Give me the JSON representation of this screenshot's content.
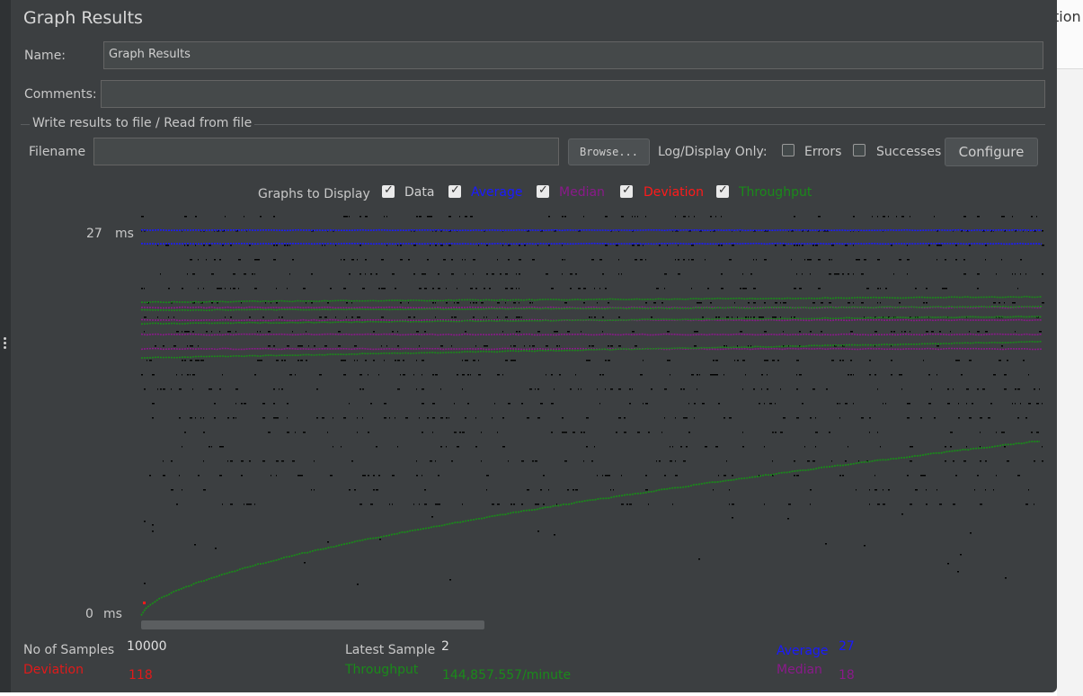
{
  "window": {
    "title": "Graph Results",
    "background_right_text": "tion"
  },
  "name_field": {
    "label": "Name:",
    "value": "Graph Results"
  },
  "comments_field": {
    "label": "Comments:",
    "value": ""
  },
  "file_group": {
    "title": "Write results to file / Read from file",
    "filename_label": "Filename",
    "filename_value": "",
    "browse_label": "Browse...",
    "log_display_label": "Log/Display Only:",
    "errors_label": "Errors",
    "errors_checked": false,
    "successes_label": "Successes",
    "successes_checked": false,
    "configure_label": "Configure"
  },
  "graphs_to_display": {
    "label": "Graphs to Display",
    "options": [
      {
        "label": "Data",
        "checked": true,
        "color": "#d0d0d0"
      },
      {
        "label": "Average",
        "checked": true,
        "color": "#1a1aff"
      },
      {
        "label": "Median",
        "checked": true,
        "color": "#8a1a8a"
      },
      {
        "label": "Deviation",
        "checked": true,
        "color": "#ff1a1a"
      },
      {
        "label": "Throughput",
        "checked": true,
        "color": "#1a8a1a"
      }
    ]
  },
  "graph": {
    "y_max_value": "27",
    "y_max_unit": "ms",
    "y_min_value": "0",
    "y_min_unit": "ms",
    "colors": {
      "data": "#000000",
      "average": "#1a1aff",
      "median": "#8a1a8a",
      "deviation": "#ff1a1a",
      "throughput": "#1a8a1a"
    }
  },
  "stats": {
    "samples_label": "No of Samples",
    "samples_value": "10000",
    "latest_label": "Latest Sample",
    "latest_value": "2",
    "average_label": "Average",
    "average_value": "27",
    "deviation_label": "Deviation",
    "deviation_value": "118",
    "throughput_label": "Throughput",
    "throughput_value": "144,857.557/minute",
    "median_label": "Median",
    "median_value": "18"
  }
}
